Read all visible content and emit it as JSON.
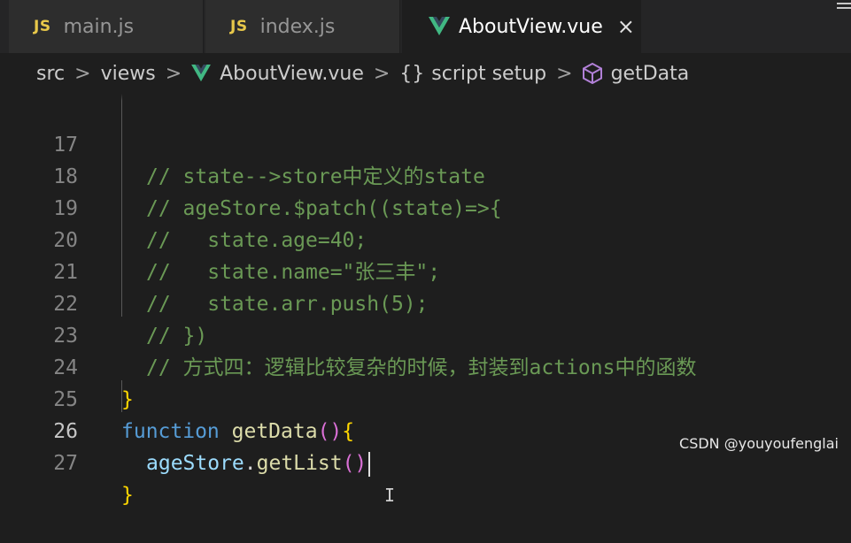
{
  "tabs": [
    {
      "icon": "JS",
      "label": "main.js"
    },
    {
      "icon": "JS",
      "label": "index.js"
    },
    {
      "label": "AboutView.vue",
      "close": "×"
    }
  ],
  "breadcrumb": {
    "src": "src",
    "views": "views",
    "file": "AboutView.vue",
    "braces": "{}",
    "script": "script setup",
    "symbol": "getData",
    "separator": ">"
  },
  "lines": [
    {
      "n": "17",
      "parts": [
        "// state-->store中定义的state"
      ]
    },
    {
      "n": "18",
      "parts": [
        "// ageStore.$patch((state)=>{"
      ]
    },
    {
      "n": "19",
      "parts": [
        "//   state.age=40;"
      ]
    },
    {
      "n": "20",
      "parts": [
        "//   state.name=\"张三丰\";"
      ]
    },
    {
      "n": "21",
      "parts": [
        "//   state.arr.push(5);"
      ]
    },
    {
      "n": "22",
      "parts": [
        "// })"
      ]
    },
    {
      "n": "23",
      "parts": [
        "// 方式四：逻辑比较复杂的时候，封装到actions中的函数"
      ]
    },
    {
      "n": "24",
      "brace": "}"
    },
    {
      "n": "25",
      "kw": "function",
      "fn": "getData",
      "paren": "()",
      "open": "{"
    },
    {
      "n": "26",
      "var": "ageStore",
      "dot": ".",
      "call": "getList",
      "paren": "()"
    },
    {
      "n": "27",
      "brace": "}"
    }
  ],
  "ibeam": "I",
  "watermark": "CSDN @youyoufenglai",
  "colors": {
    "background": "#1e1e1e",
    "comment": "#6a9955",
    "keyword": "#569cd6",
    "function": "#dcdcaa",
    "variable": "#9cdcfe",
    "vue": "#41b883",
    "js": "#e8c84a"
  }
}
